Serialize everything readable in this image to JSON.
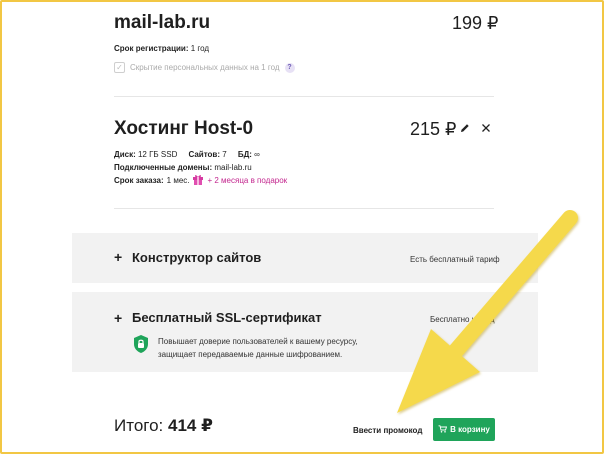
{
  "domain_item": {
    "name": "mail-lab.ru",
    "price": "199 ₽",
    "reg_label": "Срок регистрации:",
    "reg_value": "1 год",
    "privacy_label": "Скрытие персональных данных на 1 год"
  },
  "hosting": {
    "title": "Хостинг Host-0",
    "price": "215 ₽",
    "disk_label": "Диск:",
    "disk_value": "12 ГБ SSD",
    "sites_label": "Сайтов:",
    "sites_value": "7",
    "db_label": "БД:",
    "db_value": "∞",
    "domains_label": "Подключенные домены:",
    "domains_value": "mail-lab.ru",
    "term_label": "Срок заказа:",
    "term_value": "1 мес.",
    "bonus": "+ 2 месяца в подарок"
  },
  "constructor": {
    "plus": "+",
    "title": "Конструктор сайтов",
    "note": "Есть бесплатный тариф"
  },
  "ssl": {
    "plus": "+",
    "title": "Бесплатный SSL-сертификат",
    "note": "Бесплатно на год",
    "desc_line1": "Повышает доверие пользователей к вашему ресурсу,",
    "desc_line2": "защищает передаваемые данные шифрованием."
  },
  "footer": {
    "total_label": "Итого:",
    "total_value": "414 ₽",
    "promo_label": "Ввести промокод",
    "cart_label": "В корзину"
  },
  "colors": {
    "accent_green": "#1fa45a",
    "promo_pink": "#c3268e",
    "arrow_yellow": "#f5d94c",
    "frame": "#f2c744"
  },
  "icons": [
    "check-icon",
    "question-icon",
    "edit-icon",
    "close-icon",
    "gift-icon",
    "plus-icon",
    "lock-shield-icon",
    "cart-icon",
    "arrow-annotation"
  ]
}
